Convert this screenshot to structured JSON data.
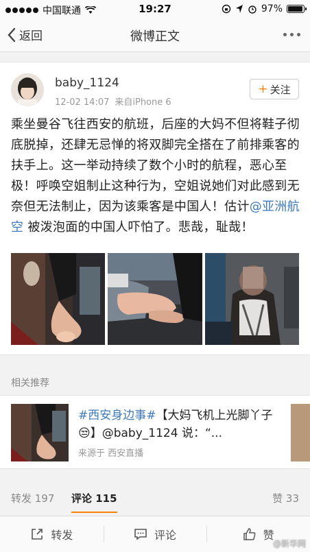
{
  "status_bar": {
    "carrier": "中国联通",
    "time": "19:27",
    "battery": "97%",
    "battery_level": 0.97,
    "icons": [
      "signal-icon",
      "wifi-icon",
      "lock-rotation-icon",
      "location-icon",
      "alarm-icon",
      "battery-icon"
    ]
  },
  "nav": {
    "back_label": "返回",
    "title": "微博正文",
    "icons": [
      "chevron-left-icon",
      "more-icon"
    ]
  },
  "post": {
    "username": "baby_1124",
    "date": "12-02 14:07",
    "source": "来自iPhone 6",
    "follow_label": "关注",
    "text_before": "乘坐曼谷飞往西安的航班，后座的大妈不但将鞋子彻底脱掉，还肆无忌惮的将双脚完全搭在了前排乘客的扶手上。这一举动持续了数个小时的航程，恶心至极！呼唤空姐制止这种行为，空姐说她们对此感到无奈但无法制止，因为该乘客是中国人！估计",
    "mention": "@亚洲航空",
    "text_after": " 被泼泡面的中国人吓怕了。悲哉，耻哉！"
  },
  "recommend": {
    "section_label": "相关推荐",
    "topic": "#西安身边事#",
    "text": "【大妈飞机上光脚丫子😒】@baby_1124 说：“...",
    "source": "来源于 西安直播"
  },
  "stats": {
    "repost": "转发 197",
    "comment": "评论 115",
    "like": "赞 33"
  },
  "actions": {
    "repost": "转发",
    "comment": "评论",
    "like": "赞"
  },
  "watermark": "@新华网",
  "colors": {
    "accent": "#ff8200",
    "link": "#3f7ab8"
  }
}
